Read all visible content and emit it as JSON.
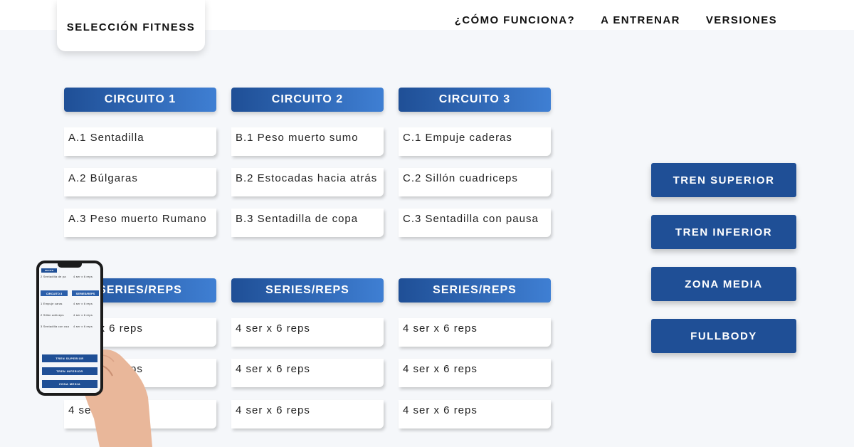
{
  "brand": {
    "title": "SELECCIÓN FITNESS"
  },
  "nav": [
    {
      "label": "¿CÓMO FUNCIONA?"
    },
    {
      "label": "A ENTRENAR"
    },
    {
      "label": "VERSIONES"
    }
  ],
  "circuits": [
    {
      "title": "CIRCUITO 1",
      "exercises": [
        "A.1 Sentadilla",
        "A.2 Búlgaras",
        "A.3 Peso muerto Rumano"
      ]
    },
    {
      "title": "CIRCUITO 2",
      "exercises": [
        "B.1 Peso muerto sumo",
        "B.2 Estocadas hacia atrás",
        "B.3 Sentadilla de copa"
      ]
    },
    {
      "title": "CIRCUITO 3",
      "exercises": [
        "C.1 Empuje caderas",
        "C.2 Sillón cuadriceps",
        "C.3 Sentadilla con pausa"
      ]
    }
  ],
  "series": [
    {
      "title": "SERIES/REPS",
      "values": [
        "4 ser x 6 reps",
        "4 ser x 6 reps",
        "4 ser x 6 reps"
      ]
    },
    {
      "title": "SERIES/REPS",
      "values": [
        "4 ser x 6 reps",
        "4 ser x 6 reps",
        "4 ser x 6 reps"
      ]
    },
    {
      "title": "SERIES/REPS",
      "values": [
        "4 ser x 6 reps",
        "4 ser x 6 reps",
        "4 ser x 6 reps"
      ]
    }
  ],
  "side_buttons": [
    {
      "label": "TREN SUPERIOR"
    },
    {
      "label": "TREN INFERIOR"
    },
    {
      "label": "ZONA MEDIA"
    },
    {
      "label": "FULLBODY"
    }
  ],
  "phone": {
    "brand": "DN FITN",
    "rows": [
      "2 Sentadilla de pa",
      "4 ser x 6 reps"
    ],
    "headers": [
      "CIRCUITO 3",
      "SERIES/REPS"
    ],
    "items": [
      [
        "1 Empuje caras",
        "4 ser x 6 reps"
      ],
      [
        "2 Sillón adriceps",
        "4 ser x 6 reps"
      ],
      [
        "3 Sentadilla con usa",
        "4 ser x 6 reps"
      ]
    ],
    "buttons": [
      "TREN SUPERIOR",
      "TREN INFERIOR",
      "ZONA MEDIA"
    ]
  },
  "colors": {
    "primary": "#1f4f96",
    "gradient_end": "#3f7fd3",
    "background": "#f5f7fa"
  }
}
